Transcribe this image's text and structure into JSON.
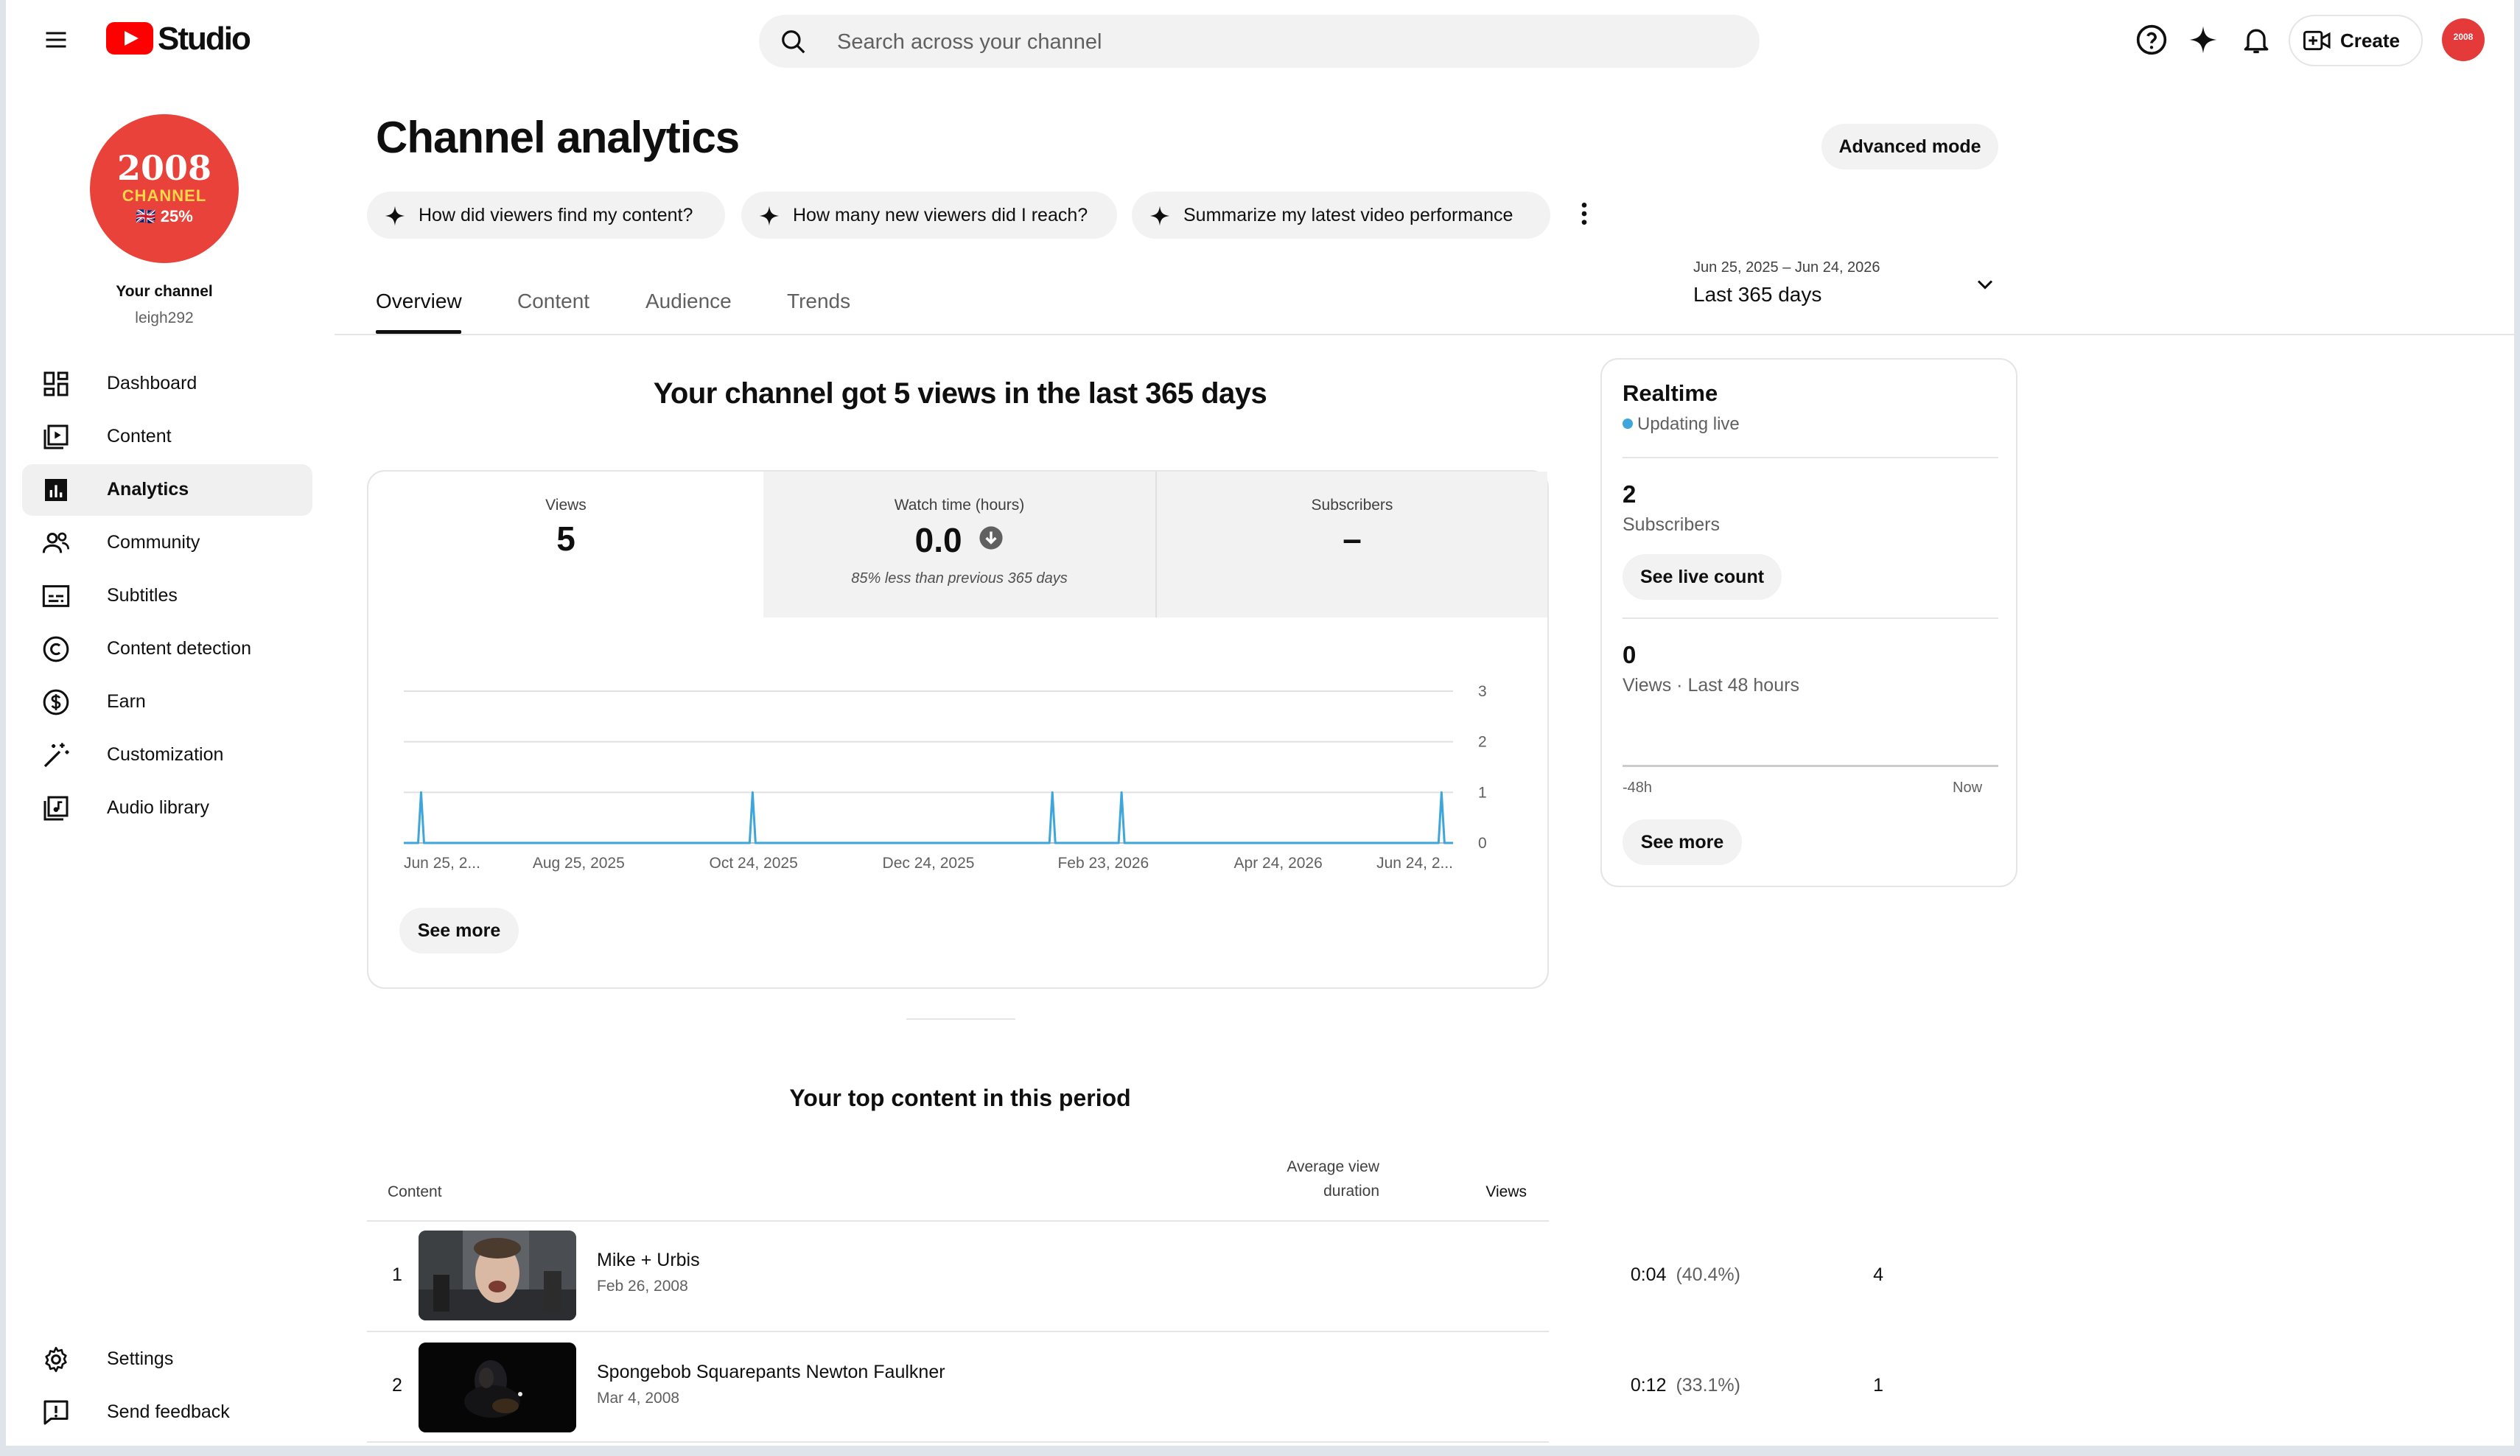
{
  "header": {
    "logo_text": "Studio",
    "search_placeholder": "Search across your channel",
    "create_label": "Create",
    "avatar_text": "2008"
  },
  "sidebar": {
    "channel_avatar_lines": [
      "2008",
      "CHANNEL",
      "🇬🇧 25%"
    ],
    "channel_label": "Your channel",
    "channel_handle": "leigh292",
    "items": [
      {
        "label": "Dashboard",
        "icon": "dashboard-icon"
      },
      {
        "label": "Content",
        "icon": "content-icon"
      },
      {
        "label": "Analytics",
        "icon": "analytics-icon",
        "active": true
      },
      {
        "label": "Community",
        "icon": "community-icon"
      },
      {
        "label": "Subtitles",
        "icon": "subtitles-icon"
      },
      {
        "label": "Content detection",
        "icon": "copyright-icon"
      },
      {
        "label": "Earn",
        "icon": "dollar-icon"
      },
      {
        "label": "Customization",
        "icon": "magic-wand-icon"
      },
      {
        "label": "Audio library",
        "icon": "audio-library-icon"
      }
    ],
    "bottom_items": [
      {
        "label": "Settings",
        "icon": "gear-icon"
      },
      {
        "label": "Send feedback",
        "icon": "feedback-icon"
      }
    ]
  },
  "page": {
    "title": "Channel analytics",
    "advanced_mode_label": "Advanced mode",
    "suggestions": [
      "How did viewers find my content?",
      "How many new viewers did I reach?",
      "Summarize my latest video performance"
    ],
    "tabs": [
      "Overview",
      "Content",
      "Audience",
      "Trends"
    ],
    "active_tab": "Overview",
    "date_range": {
      "dates": "Jun 25, 2025 – Jun 24, 2026",
      "label": "Last 365 days"
    }
  },
  "overview": {
    "headline": "Your channel got 5 views in the last 365 days",
    "metrics": [
      {
        "title": "Views",
        "value": "5",
        "note": ""
      },
      {
        "title": "Watch time (hours)",
        "value": "0.0",
        "note": "85% less than previous 365 days",
        "trend": "down"
      },
      {
        "title": "Subscribers",
        "value": "–",
        "note": ""
      }
    ],
    "see_more_label": "See more"
  },
  "chart_data": {
    "type": "line",
    "series": [
      {
        "x": [
          "Jun 25, 2025",
          "Jul 1, 2025",
          "Oct 24, 2025",
          "Feb 5, 2026",
          "Mar 1, 2026",
          "Jun 20, 2026",
          "Jun 24, 2026"
        ],
        "values": [
          0,
          1,
          1,
          1,
          1,
          1,
          0
        ],
        "spike_dates": [
          "Jul 1, 2025",
          "Oct 24, 2025",
          "Feb 5, 2026",
          "Mar 1, 2026",
          "Jun 20, 2026"
        ]
      }
    ],
    "x_range": [
      "Jun 25, 2025",
      "Jun 24, 2026"
    ],
    "x_tick_labels": [
      "Jun 25, 2...",
      "Aug 25, 2025",
      "Oct 24, 2025",
      "Dec 24, 2025",
      "Feb 23, 2026",
      "Apr 24, 2026",
      "Jun 24, 2..."
    ],
    "y_ticks": [
      0,
      1,
      2,
      3
    ],
    "ylim": [
      0,
      3
    ],
    "grid": true,
    "color": "#3ea6d8"
  },
  "realtime": {
    "title": "Realtime",
    "status": "Updating live",
    "subscribers_value": "2",
    "subscribers_label": "Subscribers",
    "live_count_label": "See live count",
    "views_value": "0",
    "views_label": "Views · Last 48 hours",
    "axis_start": "-48h",
    "axis_end": "Now",
    "see_more_label": "See more"
  },
  "top_content": {
    "title": "Your top content in this period",
    "columns": {
      "content": "Content",
      "avg_duration_line1": "Average view",
      "avg_duration_line2": "duration",
      "views": "Views"
    },
    "rows": [
      {
        "rank": "1",
        "title": "Mike + Urbis",
        "date": "Feb 26, 2008",
        "duration": "0:04",
        "percent": "(40.4%)",
        "views": "4"
      },
      {
        "rank": "2",
        "title": "Spongebob Squarepants Newton Faulkner",
        "date": "Mar 4, 2008",
        "duration": "0:12",
        "percent": "(33.1%)",
        "views": "1"
      }
    ]
  },
  "colors": {
    "accent": "#ff0000",
    "chart_line": "#3ea6d8",
    "live_dot": "#3ea6d8",
    "avatar_bg": "#e8423b"
  }
}
